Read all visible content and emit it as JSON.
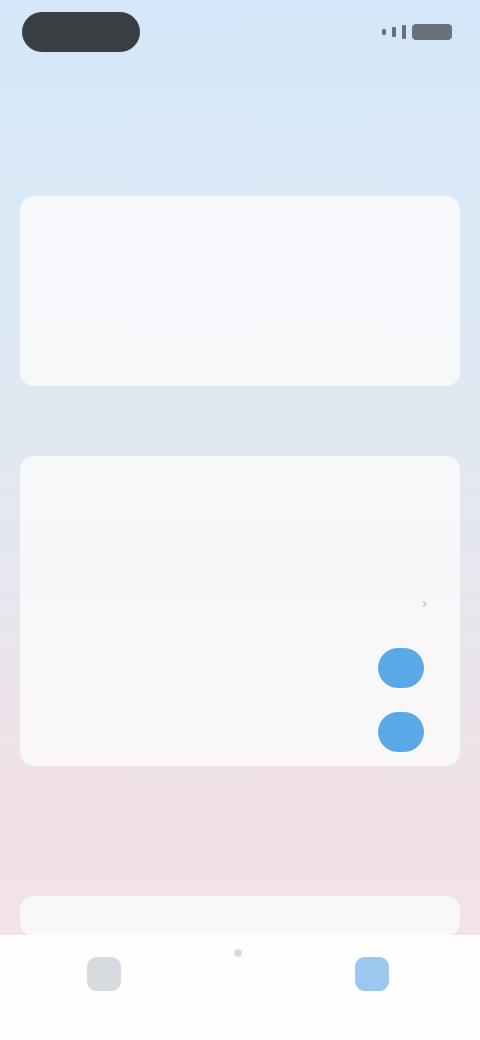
{
  "status": {
    "time": "",
    "battery": ""
  },
  "nav": {
    "back_label": "",
    "title": "",
    "action_label": ""
  },
  "sections": {
    "first": {
      "header": "",
      "rows": [
        {
          "label": "",
          "value": ""
        },
        {
          "label": "",
          "value": ""
        },
        {
          "label": "",
          "value": ""
        },
        {
          "label": "",
          "value": ""
        }
      ]
    },
    "second": {
      "header": "",
      "rows": [
        {
          "label": "",
          "value": ""
        },
        {
          "label": "",
          "value": ""
        },
        {
          "label": "",
          "value": ""
        },
        {
          "label": "",
          "value": ""
        },
        {
          "label": "",
          "value": ""
        }
      ]
    },
    "third": {
      "header": "",
      "note": "",
      "rows": [
        {
          "label": "",
          "value": ""
        }
      ]
    }
  },
  "toggles": {
    "toggle_4": true,
    "toggle_5": true
  },
  "tabbar": {
    "tabs": [
      {
        "label": "",
        "icon": "home-icon"
      },
      {
        "label": "",
        "icon": "person-icon"
      },
      {
        "label": "",
        "icon": "settings-icon"
      }
    ],
    "active_index": 2
  },
  "colors": {
    "accent": "#4a9ae0",
    "toggle_on": "#5aa8e6"
  }
}
